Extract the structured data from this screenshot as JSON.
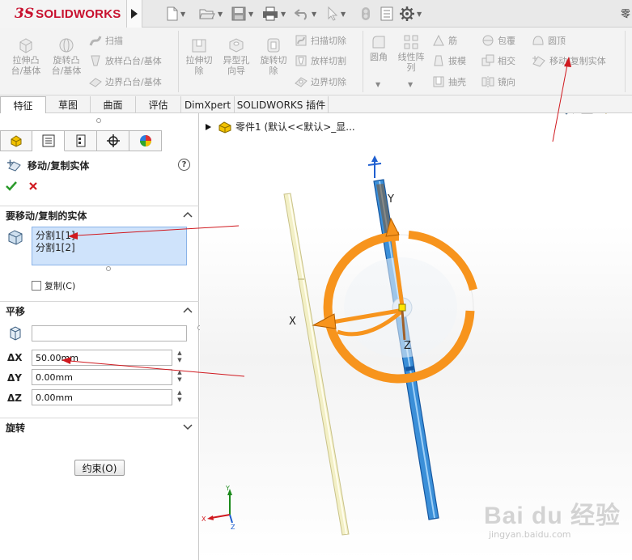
{
  "app": {
    "logo_ds": "3S",
    "logo_text": "SOLIDWORKS",
    "title_right": "零"
  },
  "ribbon": {
    "big_buttons": [
      {
        "label1": "拉伸凸",
        "label2": "台/基体"
      },
      {
        "label1": "旋转凸",
        "label2": "台/基体"
      },
      {
        "label1": "拉伸切",
        "label2": "除"
      },
      {
        "label1": "异型孔",
        "label2": "向导"
      },
      {
        "label1": "旋转切",
        "label2": "除"
      },
      {
        "label1": "圆角",
        "label2": ""
      },
      {
        "label1": "线性阵",
        "label2": "列"
      }
    ],
    "small_buttons": {
      "sweep": "扫描",
      "loft_boss": "放样凸台/基体",
      "boundary_boss": "边界凸台/基体",
      "swept_cut": "扫描切除",
      "lofted_cut": "放样切割",
      "boundary_cut": "边界切除",
      "rib": "筋",
      "draft": "拔模",
      "shell": "抽壳",
      "wrap": "包覆",
      "intersect": "相交",
      "mirror": "镜向",
      "dome": "圆顶",
      "move_copy": "移动/复制实体"
    }
  },
  "tabs": [
    {
      "label": "特征",
      "active": true
    },
    {
      "label": "草图",
      "active": false
    },
    {
      "label": "曲面",
      "active": false
    },
    {
      "label": "评估",
      "active": false
    },
    {
      "label": "DimXpert",
      "active": false
    },
    {
      "label": "SOLIDWORKS 插件",
      "active": false
    }
  ],
  "panel": {
    "title": "移动/复制实体",
    "help": "?",
    "bodies_section": "要移动/复制的实体",
    "selected_bodies": [
      "分割1[1]",
      "分割1[2]"
    ],
    "copy_label": "复制(C)",
    "copy_checked": false,
    "translate_section": "平移",
    "reference_value": "",
    "dx_label": "ΔX",
    "dy_label": "ΔY",
    "dz_label": "ΔZ",
    "dx_value": "50.00mm",
    "dy_value": "0.00mm",
    "dz_value": "0.00mm",
    "rotate_section": "旋转",
    "constraint_button": "约束(O)"
  },
  "viewport": {
    "tree_flyout": "零件1  (默认<<默认>_显...",
    "triad_labels": {
      "x": "X",
      "y": "Y",
      "z": "Z"
    },
    "mini_axes": {
      "x": "X",
      "y": "Y",
      "z": "Z"
    },
    "watermark_big": "Bai du 经验",
    "watermark_small": "jingyan.baidu.com"
  },
  "colors": {
    "logo_red": "#c8102e",
    "selection_blue": "#cfe3fb",
    "triad_orange": "#f7941d",
    "body_blue": "#1f78d1",
    "body_yellow": "#f3f0c6",
    "annotation_red": "#d0191f",
    "ok_green": "#2a9a2a",
    "cancel_red": "#d0191f"
  }
}
